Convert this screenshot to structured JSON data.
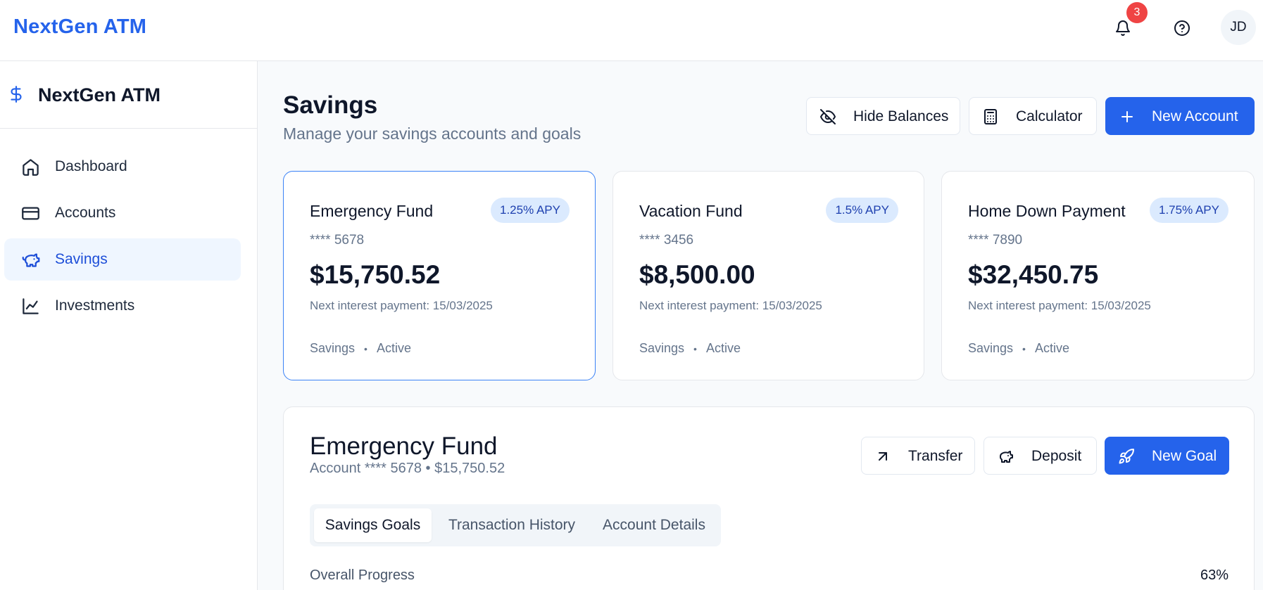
{
  "topbar": {
    "brand": "NextGen ATM",
    "notification_count": "3",
    "avatar_initials": "JD"
  },
  "sidebar": {
    "brand": "NextGen ATM",
    "items": [
      {
        "label": "Dashboard",
        "icon": "home-icon",
        "active": false
      },
      {
        "label": "Accounts",
        "icon": "credit-card-icon",
        "active": false
      },
      {
        "label": "Savings",
        "icon": "piggy-bank-icon",
        "active": true
      },
      {
        "label": "Investments",
        "icon": "line-chart-icon",
        "active": false
      }
    ]
  },
  "header": {
    "title": "Savings",
    "subtitle": "Manage your savings accounts and goals",
    "actions": {
      "hide_balances": "Hide Balances",
      "calculator": "Calculator",
      "new_account": "New Account"
    }
  },
  "accounts": [
    {
      "name": "Emergency Fund",
      "apy": "1.25% APY",
      "number": "**** 5678",
      "balance": "$15,750.52",
      "next_interest": "Next interest payment: 15/03/2025",
      "type": "Savings",
      "status": "Active",
      "selected": true
    },
    {
      "name": "Vacation Fund",
      "apy": "1.5% APY",
      "number": "**** 3456",
      "balance": "$8,500.00",
      "next_interest": "Next interest payment: 15/03/2025",
      "type": "Savings",
      "status": "Active",
      "selected": false
    },
    {
      "name": "Home Down Payment",
      "apy": "1.75% APY",
      "number": "**** 7890",
      "balance": "$32,450.75",
      "next_interest": "Next interest payment: 15/03/2025",
      "type": "Savings",
      "status": "Active",
      "selected": false
    }
  ],
  "detail": {
    "title": "Emergency Fund",
    "subtitle": "Account **** 5678 • $15,750.52",
    "actions": {
      "transfer": "Transfer",
      "deposit": "Deposit",
      "new_goal": "New Goal"
    },
    "tabs": [
      {
        "label": "Savings Goals",
        "active": true
      },
      {
        "label": "Transaction History",
        "active": false
      },
      {
        "label": "Account Details",
        "active": false
      }
    ],
    "progress_label": "Overall Progress",
    "progress_value": "63%"
  },
  "colors": {
    "accent": "#2563eb",
    "badge": "#ef4444",
    "apy_bg": "#dbeafe"
  }
}
